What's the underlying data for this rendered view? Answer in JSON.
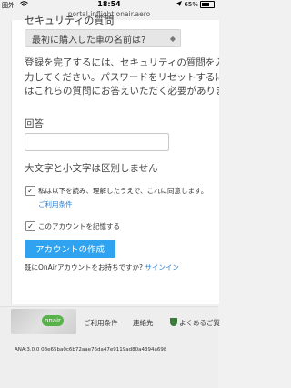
{
  "status_bar": {
    "carrier": "圏外",
    "wifi_icon": "wifi-icon",
    "time": "18:54",
    "battery_percent": "65%",
    "battery_level": 0.65
  },
  "url_bar": {
    "url": "portal.inflight.onair.aero"
  },
  "form": {
    "partial_heading": "セキュリティの質問",
    "question_select": "最初に購入した車の名前は?",
    "paragraph": "登録を完了するには、セキュリティの質問を入\n力してください。パスワードをリセットするに\nはこれらの質問にお答えいただく必要がありま",
    "answer_label": "回答",
    "answer_value": "",
    "case_note": "大文字と小文字は区別しません",
    "terms_checkbox_label": "私は以下を読み、理解したうえで、これに同意します。",
    "terms_link": "ご利用条件",
    "remember_label": "このアカウントを記憶する",
    "create_button": "アカウントの作成",
    "signin_prompt": "既にOnAirアカウントをお持ちですか?",
    "signin_link": "サインイン"
  },
  "footer": {
    "logo_text": "onair",
    "links": [
      "ご利用条件",
      "連絡先",
      "よくあるご質"
    ],
    "version": "ANA:3.0.0 08e65ba0c6b72aae76da47e9119ad80a4394a698"
  },
  "colors": {
    "accent": "#2fa3f0",
    "link": "#2a7fd4"
  }
}
